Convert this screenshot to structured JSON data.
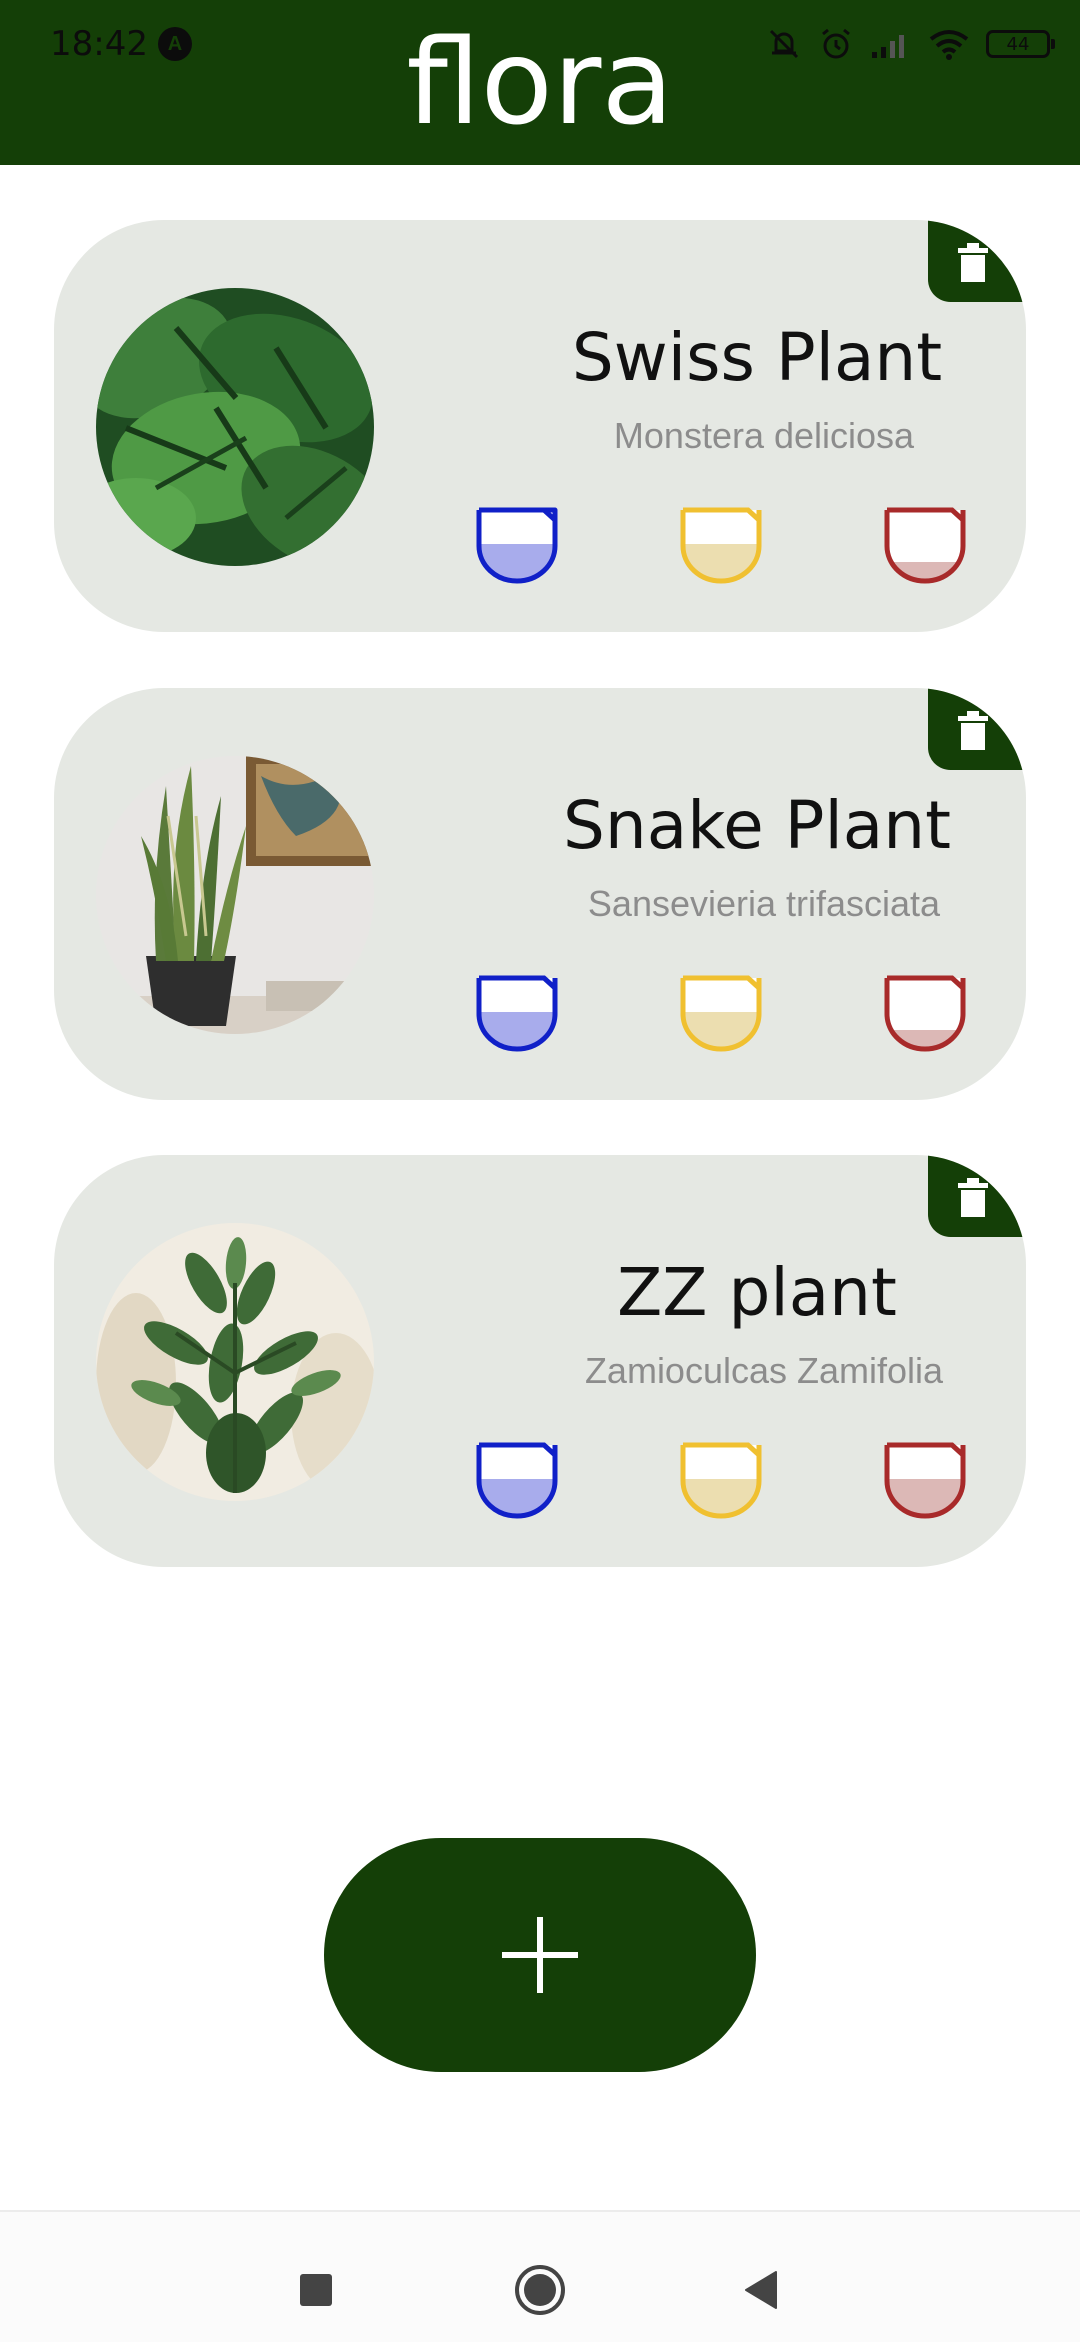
{
  "status_bar": {
    "time": "18:42",
    "app_icon_letter": "A",
    "battery_level": "44",
    "icons": [
      "bell-off-icon",
      "alarm-icon",
      "signal-icon",
      "wifi-icon",
      "battery-icon"
    ]
  },
  "app": {
    "title": "flora"
  },
  "plants": [
    {
      "name": "Swiss Plant",
      "species": "Monstera deliciosa",
      "water_level": 0.5,
      "light_level": 0.45,
      "temperature_level": 0.25
    },
    {
      "name": "Snake Plant",
      "species": "Sansevieria trifasciata",
      "water_level": 0.5,
      "light_level": 0.45,
      "temperature_level": 0.25
    },
    {
      "name": "ZZ plant",
      "species": "Zamioculcas Zamifolia",
      "water_level": 0.5,
      "light_level": 0.45,
      "temperature_level": 0.45
    }
  ],
  "colors": {
    "primary": "#143f07",
    "card_bg": "#e5e8e3",
    "water_stroke": "#1020c8",
    "water_fill": "#a8acec",
    "light_stroke": "#f0c030",
    "light_fill": "#ecdeb0",
    "temp_stroke": "#a82a2a",
    "temp_fill": "#dcb8b6"
  },
  "actions": {
    "add_icon": "plus-icon",
    "delete_icon": "trash-icon"
  },
  "nav": {
    "icons": [
      "recent-apps-icon",
      "home-icon",
      "back-icon"
    ]
  }
}
